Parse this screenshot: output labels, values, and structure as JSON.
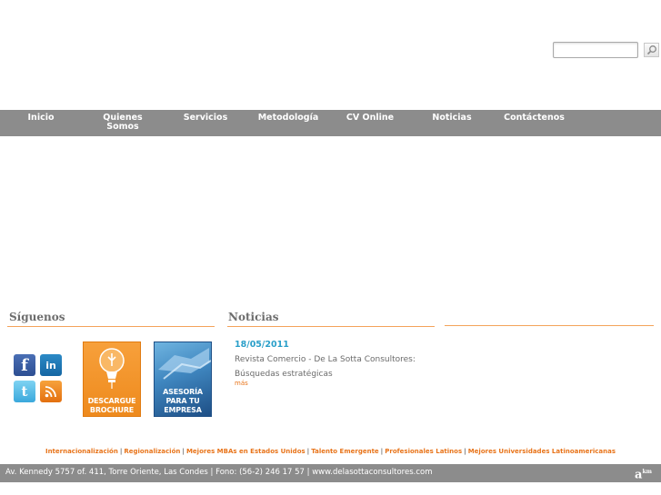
{
  "search": {
    "value": "",
    "placeholder": "",
    "button_icon": "magnifier-icon"
  },
  "nav": {
    "items": [
      {
        "line1": "Inicio",
        "line2": ""
      },
      {
        "line1": "Quienes",
        "line2": "Somos"
      },
      {
        "line1": "Servicios",
        "line2": ""
      },
      {
        "line1": "Metodología",
        "line2": ""
      },
      {
        "line1": "CV Online",
        "line2": ""
      },
      {
        "line1": "Noticias",
        "line2": ""
      },
      {
        "line1": "Contáctenos",
        "line2": ""
      }
    ]
  },
  "sections": {
    "follow_title": "Síguenos",
    "news_title": "Noticias"
  },
  "social": {
    "facebook": "f",
    "linkedin": "in",
    "twitter": "t",
    "rss": "rss-icon"
  },
  "banners": {
    "brochure": {
      "line1": "DESCARGUE",
      "line2": "BROCHURE"
    },
    "advisory": {
      "line1": "ASESORÍA",
      "line2": "PARA TU",
      "line3": "EMPRESA"
    }
  },
  "news": {
    "date": "18/05/2011",
    "title": "Revista Comercio - De La Sotta Consultores: Búsquedas estratégicas",
    "more": "más"
  },
  "links": [
    "Internacionalización",
    "Regionalización",
    "Mejores MBAs en Estados Unidos",
    "Talento Emergente",
    "Profesionales Latinos",
    "Mejores Universidades Latinoamericanas"
  ],
  "link_separator": "|",
  "footer": {
    "text": "Av. Kennedy 5757 of. 411, Torre Oriente, Las Condes | Fono: (56-2) 246 17 57 | www.delasottaconsultores.com",
    "logo": "a",
    "logo_mark": "km"
  },
  "colors": {
    "nav_bg": "#8c8c8c",
    "accent_orange": "#e8741a",
    "date_blue": "#2a9fc9",
    "rule_orange": "#f4a35a"
  }
}
